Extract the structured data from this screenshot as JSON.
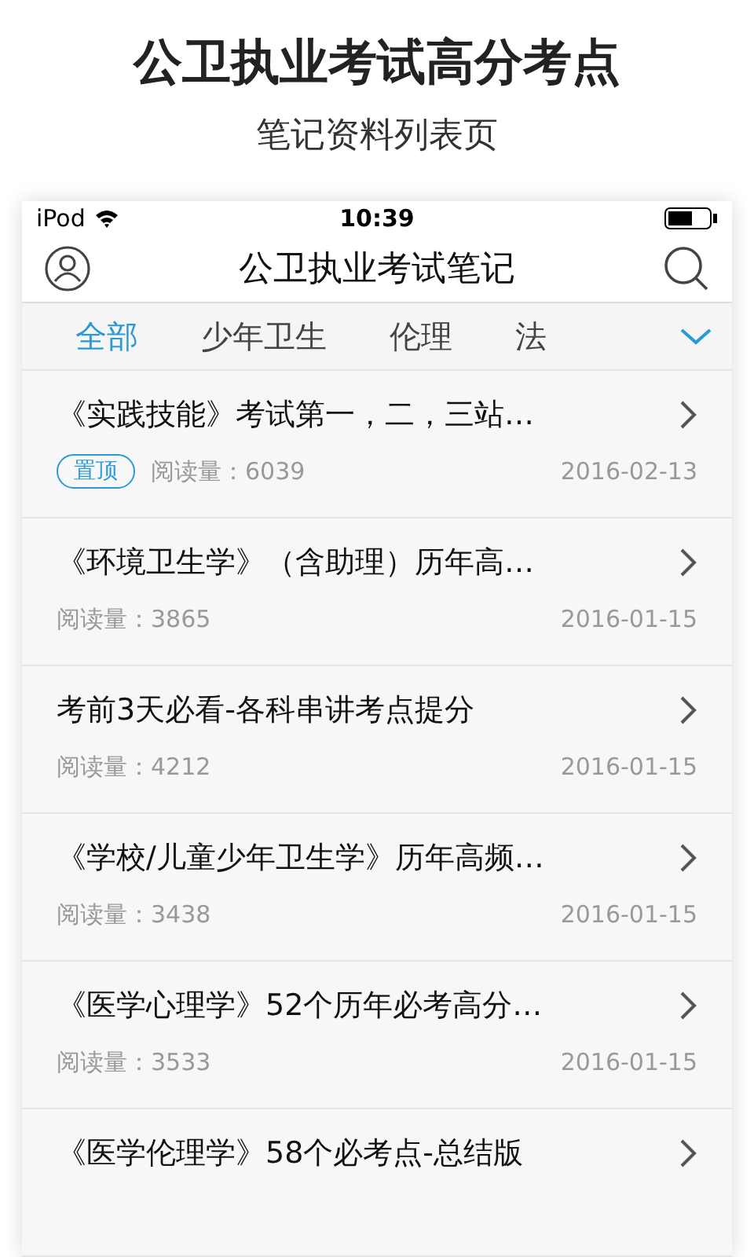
{
  "promo": {
    "headline": "公卫执业考试高分考点",
    "subtitle": "笔记资料列表页"
  },
  "status_bar": {
    "carrier": "iPod",
    "time": "10:39"
  },
  "nav": {
    "title": "公卫执业考试笔记"
  },
  "tabs": [
    {
      "label": "全部",
      "selected": true
    },
    {
      "label": "少年卫生",
      "selected": false
    },
    {
      "label": "伦理",
      "selected": false
    },
    {
      "label": "法",
      "selected": false
    }
  ],
  "articles": [
    {
      "title": "《实践技能》考试第一，二，三站…",
      "pinned": true,
      "badge": "置顶",
      "reads": "阅读量：6039",
      "date": "2016-02-13"
    },
    {
      "title": "《环境卫生学》（含助理）历年高…",
      "pinned": false,
      "reads": "阅读量：3865",
      "date": "2016-01-15"
    },
    {
      "title": "考前3天必看-各科串讲考点提分",
      "pinned": false,
      "reads": "阅读量：4212",
      "date": "2016-01-15"
    },
    {
      "title": "《学校/儿童少年卫生学》历年高频…",
      "pinned": false,
      "reads": "阅读量：3438",
      "date": "2016-01-15"
    },
    {
      "title": "《医学心理学》52个历年必考高分…",
      "pinned": false,
      "reads": "阅读量：3533",
      "date": "2016-01-15"
    },
    {
      "title": "《医学伦理学》58个必考点-总结版",
      "pinned": false
    }
  ]
}
